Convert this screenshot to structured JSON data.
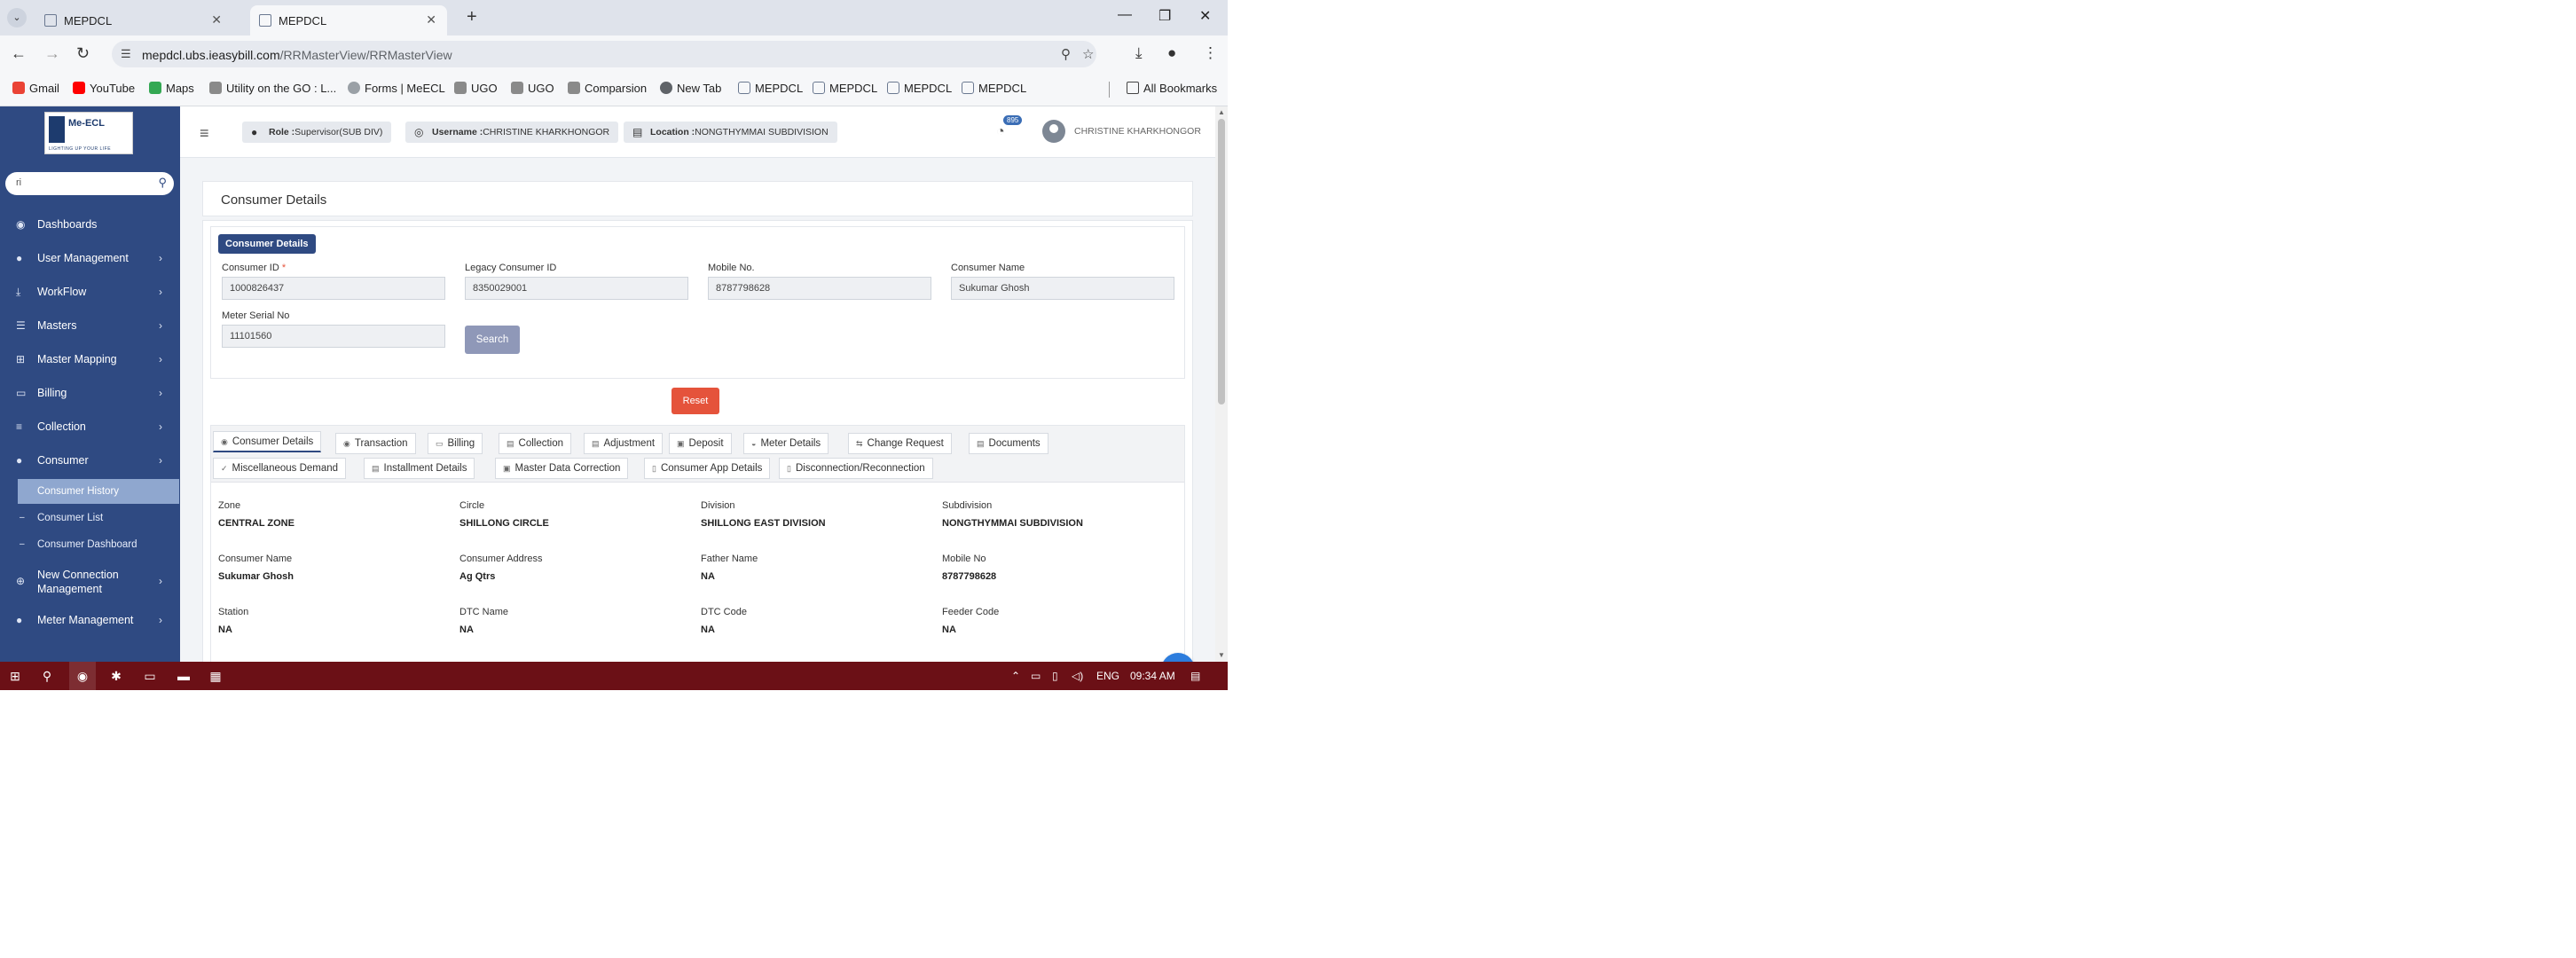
{
  "browser": {
    "tabs": [
      {
        "title": "MEPDCL",
        "active": false
      },
      {
        "title": "MEPDCL",
        "active": true
      }
    ],
    "url_host": "mepdcl.ubs.ieasybill.com",
    "url_path": "/RRMasterView/RRMasterView",
    "bookmarks": [
      {
        "label": "Gmail",
        "icon": "gmail-icon",
        "color": "#ea4335"
      },
      {
        "label": "YouTube",
        "icon": "youtube-icon",
        "color": "#ff0000"
      },
      {
        "label": "Maps",
        "icon": "maps-icon",
        "color": "#34a853"
      },
      {
        "label": "Utility on the GO : L...",
        "icon": "u-icon",
        "color": "#8a8a8a"
      },
      {
        "label": "Forms | MeECL",
        "icon": "forms-icon",
        "color": "#9aa0a6"
      },
      {
        "label": "UGO",
        "icon": "u-icon",
        "color": "#8a8a8a"
      },
      {
        "label": "UGO",
        "icon": "u-icon",
        "color": "#8a8a8a"
      },
      {
        "label": "Comparsion",
        "icon": "u-icon",
        "color": "#8a8a8a"
      },
      {
        "label": "New Tab",
        "icon": "globe-icon",
        "color": "#5f6368"
      },
      {
        "label": "MEPDCL",
        "icon": "doc-icon",
        "color": "#6a7890"
      },
      {
        "label": "MEPDCL",
        "icon": "doc-icon",
        "color": "#6a7890"
      },
      {
        "label": "MEPDCL",
        "icon": "doc-icon",
        "color": "#6a7890"
      },
      {
        "label": "MEPDCL",
        "icon": "doc-icon",
        "color": "#6a7890"
      }
    ],
    "all_bookmarks": "All Bookmarks"
  },
  "sidebar": {
    "logo_text": "Me-ECL",
    "logo_tagline": "LIGHTING UP YOUR LIFE",
    "search_value": "ri",
    "menu": [
      {
        "label": "Dashboards",
        "icon": "dashboard-icon",
        "has_chevron": false
      },
      {
        "label": "User Management",
        "icon": "user-icon",
        "has_chevron": true
      },
      {
        "label": "WorkFlow",
        "icon": "workflow-icon",
        "has_chevron": true
      },
      {
        "label": "Masters",
        "icon": "masters-icon",
        "has_chevron": true
      },
      {
        "label": "Master Mapping",
        "icon": "mapping-icon",
        "has_chevron": true
      },
      {
        "label": "Billing",
        "icon": "billing-icon",
        "has_chevron": true
      },
      {
        "label": "Collection",
        "icon": "collection-icon",
        "has_chevron": true
      },
      {
        "label": "Consumer",
        "icon": "consumer-icon",
        "has_chevron": true
      }
    ],
    "consumer_sub": [
      {
        "label": "Consumer History",
        "active": true
      },
      {
        "label": "Consumer List",
        "active": false
      },
      {
        "label": "Consumer Dashboard",
        "active": false
      }
    ],
    "menu_after": [
      {
        "label": "New Connection Management",
        "icon": "new-connection-icon",
        "has_chevron": true
      },
      {
        "label": "Meter Management",
        "icon": "meter-icon",
        "has_chevron": true
      }
    ]
  },
  "topbar": {
    "role_label": "Role :",
    "role_value": "Supervisor(SUB DIV)",
    "username_label": "Username :",
    "username_value": "CHRISTINE KHARKHONGOR",
    "location_label": "Location :",
    "location_value": "NONGTHYMMAI SUBDIVISION",
    "notification_count": "895",
    "user_display": "CHRISTINE KHARKHONGOR"
  },
  "main": {
    "page_title": "Consumer Details",
    "section_badge": "Consumer Details",
    "fields": {
      "consumer_id_label": "Consumer ID",
      "consumer_id_value": "1000826437",
      "legacy_id_label": "Legacy Consumer ID",
      "legacy_id_value": "8350029001",
      "mobile_label": "Mobile No.",
      "mobile_value": "8787798628",
      "consumer_name_label": "Consumer Name",
      "consumer_name_value": "Sukumar Ghosh",
      "meter_serial_label": "Meter Serial No",
      "meter_serial_value": "11101560"
    },
    "search_label": "Search",
    "reset_label": "Reset",
    "tabs_row1": [
      "Consumer Details",
      "Transaction",
      "Billing",
      "Collection",
      "Adjustment",
      "Deposit",
      "Meter Details",
      "Change Request",
      "Documents"
    ],
    "tabs_row2": [
      "Miscellaneous Demand",
      "Installment Details",
      "Master Data Correction",
      "Consumer App Details",
      "Disconnection/Reconnection"
    ],
    "details": [
      {
        "label": "Zone",
        "value": "CENTRAL ZONE"
      },
      {
        "label": "Circle",
        "value": "SHILLONG CIRCLE"
      },
      {
        "label": "Division",
        "value": "SHILLONG EAST DIVISION"
      },
      {
        "label": "Subdivision",
        "value": "NONGTHYMMAI SUBDIVISION"
      },
      {
        "label": "Consumer Name",
        "value": "Sukumar Ghosh"
      },
      {
        "label": "Consumer Address",
        "value": "Ag Qtrs"
      },
      {
        "label": "Father Name",
        "value": "NA"
      },
      {
        "label": "Mobile No",
        "value": "8787798628"
      },
      {
        "label": "Station",
        "value": "NA"
      },
      {
        "label": "DTC Name",
        "value": "NA"
      },
      {
        "label": "DTC Code",
        "value": "NA"
      },
      {
        "label": "Feeder Code",
        "value": "NA"
      }
    ]
  },
  "taskbar": {
    "language": "ENG",
    "time": "09:34 AM"
  },
  "colors": {
    "sidebar": "#2f4a82",
    "accent": "#2f4a82",
    "reset": "#e5533b",
    "search_btn": "#8f98b8",
    "taskbar": "#6b1016",
    "fab": "#2d7ddd"
  }
}
